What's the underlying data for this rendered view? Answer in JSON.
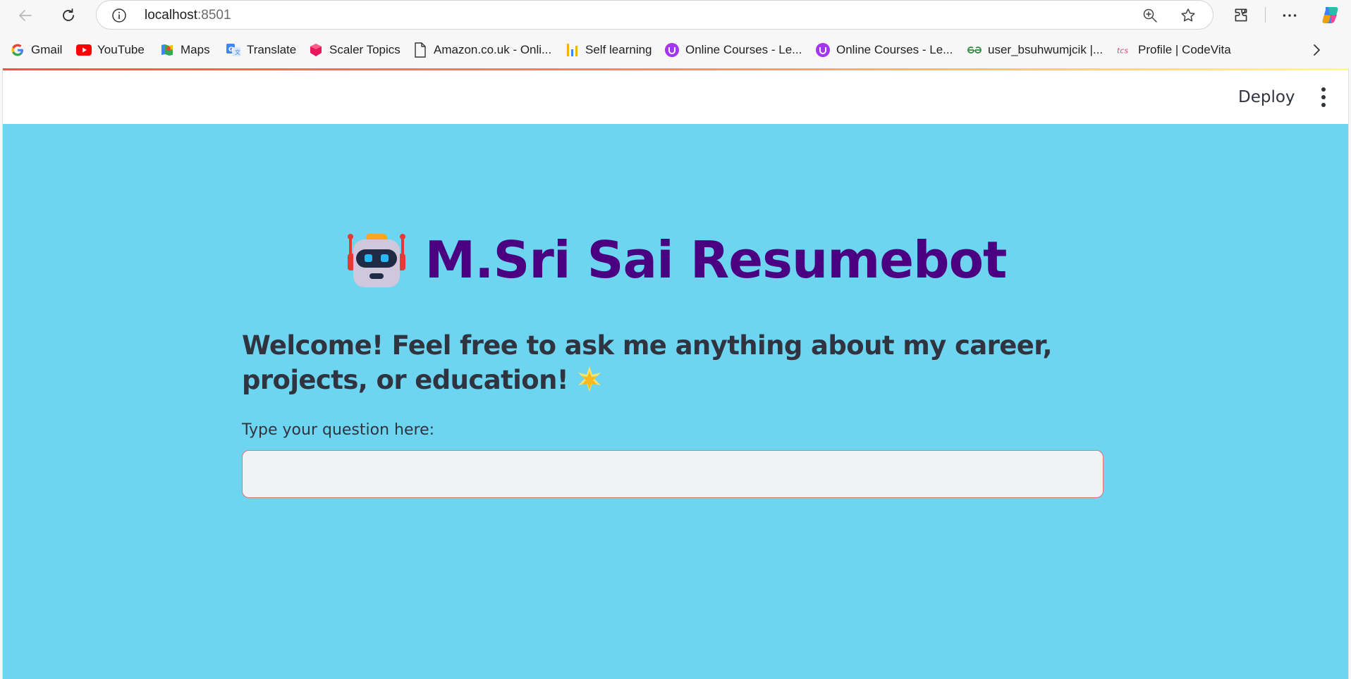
{
  "browser": {
    "url_host": "localhost",
    "url_port": ":8501"
  },
  "bookmarks": [
    {
      "label": "Gmail",
      "icon": "google-icon"
    },
    {
      "label": "YouTube",
      "icon": "youtube-icon"
    },
    {
      "label": "Maps",
      "icon": "maps-icon"
    },
    {
      "label": "Translate",
      "icon": "translate-icon"
    },
    {
      "label": "Scaler Topics",
      "icon": "scaler-icon"
    },
    {
      "label": "Amazon.co.uk - Onli...",
      "icon": "document-icon"
    },
    {
      "label": "Self learning",
      "icon": "chart-bars-icon"
    },
    {
      "label": "Online Courses - Le...",
      "icon": "udemy-icon"
    },
    {
      "label": "Online Courses - Le...",
      "icon": "udemy-icon"
    },
    {
      "label": "user_bsuhwumjcik |...",
      "icon": "geeksforgeeks-icon"
    },
    {
      "label": "Profile | CodeVita",
      "icon": "tcs-icon"
    }
  ],
  "app": {
    "deploy_label": "Deploy",
    "title": "M.Sri Sai Resumebot",
    "welcome": "Welcome! Feel free to ask me anything about my career, projects, or education!",
    "question_label": "Type your question here:",
    "question_value": ""
  },
  "colors": {
    "main_background": "#6dd5f0",
    "title_color": "#4b0082",
    "text_color": "#31333f",
    "input_border": "#e0707a"
  }
}
